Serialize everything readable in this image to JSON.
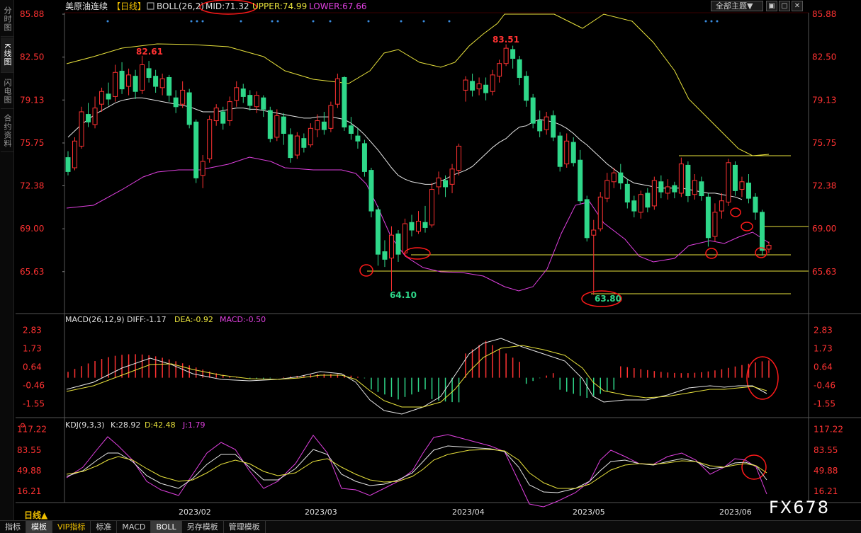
{
  "sidebar": {
    "tabs": [
      {
        "label": "分时图",
        "active": false
      },
      {
        "label": "K线图",
        "active": true
      },
      {
        "label": "闪电图",
        "active": false
      },
      {
        "label": "合约资料",
        "active": false
      }
    ]
  },
  "header": {
    "symbol": "美原油连续",
    "period_tag": "【日线】",
    "boll_label": "BOLL(26,2)",
    "mid": "MID:71.32",
    "upper": "UPPER:74.99",
    "lower": "LOWER:67.66",
    "theme_button": "全部主题▼"
  },
  "window_buttons": [
    "▣",
    "▢",
    "✕"
  ],
  "macd_header": {
    "label": "MACD(26,12,9)",
    "diff": "DIFF:-1.17",
    "dea": "DEA:-0.92",
    "macd": "MACD:-0.50"
  },
  "kdj_header": {
    "label": "KDJ(9,3,3)",
    "k": "K:28.92",
    "d": "D:42.48",
    "j": "J:1.79"
  },
  "price_axis": {
    "ticks": [
      85.88,
      82.5,
      79.13,
      75.75,
      72.38,
      69.0,
      65.63
    ],
    "labels": [
      "85.88",
      "82.50",
      "79.13",
      "75.75",
      "72.38",
      "69.00",
      "65.63"
    ],
    "min": 62.5,
    "max": 85.88
  },
  "macd_axis": {
    "labels": [
      "2.83",
      "1.73",
      "0.64",
      "-0.46",
      "-1.55"
    ],
    "ticks": [
      2.83,
      1.73,
      0.64,
      -0.46,
      -1.55
    ]
  },
  "kdj_axis": {
    "labels": [
      "117.22",
      "83.55",
      "49.88",
      "16.21"
    ],
    "ticks": [
      117.22,
      83.55,
      49.88,
      16.21
    ]
  },
  "date_labels": [
    "2023/02",
    "2023/03",
    "2023/04",
    "2023/05",
    "2023/06"
  ],
  "price_annotations": {
    "high1": "82.61",
    "high2": "83.51",
    "low1": "64.10",
    "low2": "63.80"
  },
  "period_label": "日线▲",
  "watermark": "FX678",
  "bottom_bar": [
    "指标",
    "模板",
    "VIP指标",
    "标准",
    "MACD",
    "BOLL",
    "另存模板",
    "管理模板"
  ],
  "bottom_bar_active": [
    "模板",
    "BOLL"
  ],
  "colors": {
    "up": "#ff3232",
    "down": "#2fd88a",
    "mid": "#e6e6e6",
    "upper": "#e8e23c",
    "lower": "#e040e0",
    "axis_text": "#ff3232",
    "circle": "#ff1a1a"
  },
  "chart_data": {
    "type": "candlestick",
    "candles": [
      [
        74.6,
        73.5,
        75.1,
        73.2
      ],
      [
        73.8,
        75.9,
        76.2,
        73.6
      ],
      [
        75.5,
        78.2,
        78.6,
        75.3
      ],
      [
        78.0,
        77.4,
        78.9,
        77.0
      ],
      [
        77.2,
        78.5,
        79.4,
        76.9
      ],
      [
        78.8,
        79.8,
        80.1,
        78.2
      ],
      [
        79.6,
        79.2,
        80.5,
        78.7
      ],
      [
        79.4,
        81.3,
        81.9,
        79.0
      ],
      [
        81.4,
        80.0,
        82.1,
        79.6
      ],
      [
        80.2,
        81.1,
        81.6,
        79.5
      ],
      [
        81.0,
        79.8,
        81.5,
        79.2
      ],
      [
        79.9,
        81.9,
        82.61,
        79.6
      ],
      [
        81.6,
        80.9,
        82.2,
        80.5
      ],
      [
        81.0,
        80.2,
        81.5,
        79.7
      ],
      [
        80.1,
        80.8,
        81.2,
        79.5
      ],
      [
        80.9,
        79.5,
        81.1,
        79.0
      ],
      [
        79.3,
        78.6,
        79.9,
        78.1
      ],
      [
        78.8,
        79.9,
        80.6,
        78.5
      ],
      [
        79.7,
        77.2,
        80.0,
        76.9
      ],
      [
        77.4,
        73.0,
        77.6,
        72.6
      ],
      [
        73.2,
        74.3,
        74.8,
        72.2
      ],
      [
        74.5,
        77.6,
        77.9,
        74.2
      ],
      [
        77.5,
        78.5,
        78.8,
        77.1
      ],
      [
        78.2,
        77.3,
        78.6,
        76.8
      ],
      [
        77.5,
        79.0,
        79.4,
        77.1
      ],
      [
        79.1,
        80.1,
        80.6,
        78.6
      ],
      [
        80.0,
        79.4,
        80.4,
        78.9
      ],
      [
        79.5,
        78.7,
        79.9,
        78.3
      ],
      [
        78.6,
        79.5,
        79.8,
        78.1
      ],
      [
        79.3,
        78.4,
        79.5,
        77.8
      ],
      [
        78.3,
        76.1,
        78.6,
        75.8
      ],
      [
        76.2,
        77.9,
        78.4,
        75.9
      ],
      [
        77.8,
        76.5,
        78.1,
        75.6
      ],
      [
        76.4,
        74.6,
        76.9,
        74.2
      ],
      [
        74.8,
        76.3,
        76.6,
        74.5
      ],
      [
        76.1,
        75.4,
        76.5,
        75.0
      ],
      [
        75.6,
        76.9,
        77.3,
        75.4
      ],
      [
        76.8,
        77.5,
        78.0,
        76.2
      ],
      [
        77.4,
        76.8,
        78.2,
        76.4
      ],
      [
        76.9,
        78.7,
        79.0,
        76.6
      ],
      [
        78.8,
        80.8,
        81.2,
        78.5
      ],
      [
        80.9,
        77.0,
        81.0,
        76.7
      ],
      [
        77.1,
        76.5,
        77.8,
        76.0
      ],
      [
        76.3,
        75.9,
        76.9,
        75.3
      ],
      [
        75.7,
        73.5,
        76.0,
        73.1
      ],
      [
        73.6,
        70.4,
        73.8,
        69.9
      ],
      [
        70.5,
        67.0,
        70.8,
        66.1
      ],
      [
        67.2,
        66.6,
        68.1,
        66.0
      ],
      [
        66.7,
        68.5,
        69.2,
        64.1
      ],
      [
        68.6,
        67.0,
        68.9,
        66.4
      ],
      [
        67.1,
        69.4,
        69.8,
        66.9
      ],
      [
        69.5,
        68.9,
        70.1,
        68.4
      ],
      [
        68.8,
        69.6,
        70.4,
        68.6
      ],
      [
        69.5,
        69.1,
        70.8,
        68.7
      ],
      [
        69.3,
        72.1,
        72.6,
        69.1
      ],
      [
        72.3,
        73.0,
        73.5,
        71.7
      ],
      [
        72.8,
        72.3,
        73.2,
        71.5
      ],
      [
        72.5,
        73.7,
        74.1,
        71.8
      ],
      [
        73.6,
        75.5,
        75.7,
        73.2
      ],
      [
        79.9,
        80.7,
        81.0,
        79.0
      ],
      [
        80.6,
        79.9,
        81.2,
        79.4
      ],
      [
        80.0,
        80.4,
        80.9,
        79.5
      ],
      [
        80.3,
        79.7,
        80.9,
        79.1
      ],
      [
        79.8,
        81.1,
        81.5,
        79.5
      ],
      [
        81.0,
        82.0,
        82.3,
        80.5
      ],
      [
        82.0,
        83.2,
        83.51,
        81.8
      ],
      [
        83.1,
        82.4,
        83.4,
        81.6
      ],
      [
        82.3,
        80.9,
        82.6,
        80.3
      ],
      [
        81.0,
        79.1,
        81.4,
        78.6
      ],
      [
        79.3,
        77.3,
        79.6,
        76.9
      ],
      [
        77.5,
        76.7,
        78.3,
        76.2
      ],
      [
        76.8,
        77.8,
        78.2,
        76.4
      ],
      [
        77.9,
        76.2,
        78.3,
        75.9
      ],
      [
        76.3,
        73.9,
        76.6,
        73.5
      ],
      [
        74.1,
        75.9,
        76.5,
        73.8
      ],
      [
        75.8,
        74.2,
        76.2,
        73.9
      ],
      [
        74.4,
        71.2,
        75.2,
        70.9
      ],
      [
        71.3,
        68.3,
        71.6,
        68.0
      ],
      [
        68.5,
        68.9,
        69.7,
        63.8
      ],
      [
        69.0,
        71.5,
        71.9,
        68.8
      ],
      [
        71.4,
        72.8,
        73.4,
        71.1
      ],
      [
        72.7,
        73.4,
        73.8,
        72.2
      ],
      [
        73.4,
        72.6,
        74.1,
        72.1
      ],
      [
        72.5,
        71.1,
        72.9,
        70.6
      ],
      [
        71.2,
        70.4,
        71.6,
        69.9
      ],
      [
        70.3,
        71.7,
        72.0,
        69.8
      ],
      [
        71.8,
        70.7,
        72.2,
        70.3
      ],
      [
        70.8,
        72.8,
        73.1,
        70.5
      ],
      [
        72.7,
        71.9,
        73.2,
        71.4
      ],
      [
        71.8,
        72.3,
        72.9,
        71.3
      ],
      [
        72.4,
        71.9,
        72.7,
        71.4
      ],
      [
        71.8,
        74.1,
        74.6,
        71.5
      ],
      [
        74.0,
        71.6,
        74.3,
        71.1
      ],
      [
        71.7,
        72.8,
        73.3,
        71.3
      ],
      [
        72.7,
        71.6,
        73.1,
        71.2
      ],
      [
        71.5,
        68.3,
        71.8,
        67.6
      ],
      [
        68.4,
        70.3,
        71.0,
        68.0
      ],
      [
        70.4,
        71.2,
        71.8,
        69.8
      ],
      [
        71.1,
        74.2,
        74.5,
        70.8
      ],
      [
        74.0,
        72.0,
        74.3,
        71.6
      ],
      [
        72.1,
        72.7,
        73.1,
        71.5
      ],
      [
        72.6,
        71.4,
        73.3,
        71.0
      ],
      [
        71.5,
        70.3,
        71.8,
        69.7
      ],
      [
        70.3,
        67.3,
        70.5,
        66.9
      ],
      [
        67.4,
        67.7,
        68.0,
        67.1
      ]
    ],
    "boll_mid": [
      76.2,
      76.7,
      77.2,
      77.6,
      78.0,
      78.3,
      78.6,
      78.9,
      79.1,
      79.2,
      79.3,
      79.3,
      79.2,
      79.1,
      79.0,
      78.9,
      78.8,
      78.7,
      78.6,
      78.4,
      78.2,
      78.2,
      78.2,
      78.3,
      78.4,
      78.5,
      78.5,
      78.4,
      78.4,
      78.3,
      78.2,
      78.1,
      78.0,
      77.9,
      77.8,
      77.7,
      77.7,
      77.8,
      77.8,
      77.8,
      77.7,
      77.6,
      77.3,
      76.9,
      76.4,
      75.8,
      75.2,
      74.5,
      73.8,
      73.2,
      72.9,
      72.7,
      72.6,
      72.5,
      72.5,
      72.7,
      72.9,
      73.2,
      73.4,
      73.6,
      73.9,
      74.4,
      74.9,
      75.4,
      75.8,
      76.1,
      76.6,
      77.0,
      77.1,
      77.4,
      77.6,
      77.5,
      77.4,
      77.2,
      76.9,
      76.5,
      76.0,
      75.6,
      75.1,
      74.6,
      74.1,
      73.7,
      73.3,
      72.9,
      72.6,
      72.5,
      72.4,
      72.3,
      72.2,
      72.2,
      72.2,
      72.2,
      72.1,
      72.0,
      71.9,
      71.8,
      71.8,
      71.7,
      71.6,
      71.5,
      71.3
    ],
    "title": "美原油连续 日线",
    "ylim": [
      62.5,
      85.88
    ]
  }
}
